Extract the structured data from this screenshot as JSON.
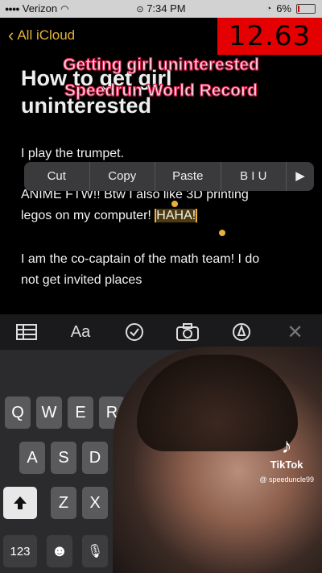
{
  "status_bar": {
    "carrier": "Verizon",
    "time": "7:34 PM",
    "battery": "6%",
    "battery_level": 0.06,
    "battery_color": "#dd0000"
  },
  "nav": {
    "back_label": "All iCloud",
    "accent": "#e8b13a"
  },
  "timer": {
    "value": "12.63",
    "color": "#e40000"
  },
  "overlay": {
    "line1": "Getting girl uninterested",
    "line2": "Speedrun World Record"
  },
  "note": {
    "title_line1": "How to get girl",
    "title_line2": "uninterested",
    "p1": "I play the trumpet.",
    "p2_line1": "ANIME FTW!! Btw I also like 3D printing",
    "p2_line2_before": "legos on my computer! ",
    "p2_selected": "HAHA!",
    "p3_line1": "I am the co-captain of the math team! I do",
    "p3_line2": "not get invited places"
  },
  "context_menu": {
    "cut": "Cut",
    "copy": "Copy",
    "paste": "Paste",
    "format": "B I U",
    "more": "▶"
  },
  "toolbar": {
    "icons": [
      "table-icon",
      "text-format-icon",
      "checklist-icon",
      "camera-icon",
      "markup-icon",
      "close-icon"
    ],
    "text_format_label": "Aa"
  },
  "keyboard": {
    "row1": [
      "Q",
      "W",
      "E",
      "R"
    ],
    "row2": [
      "A",
      "S",
      "D"
    ],
    "row3": [
      "Z",
      "X"
    ],
    "numbers_key": "123",
    "emoji_key": "☻",
    "mic_key": "🎙"
  },
  "watermark": {
    "brand": "TikTok",
    "user": "@ speeduncle99"
  }
}
